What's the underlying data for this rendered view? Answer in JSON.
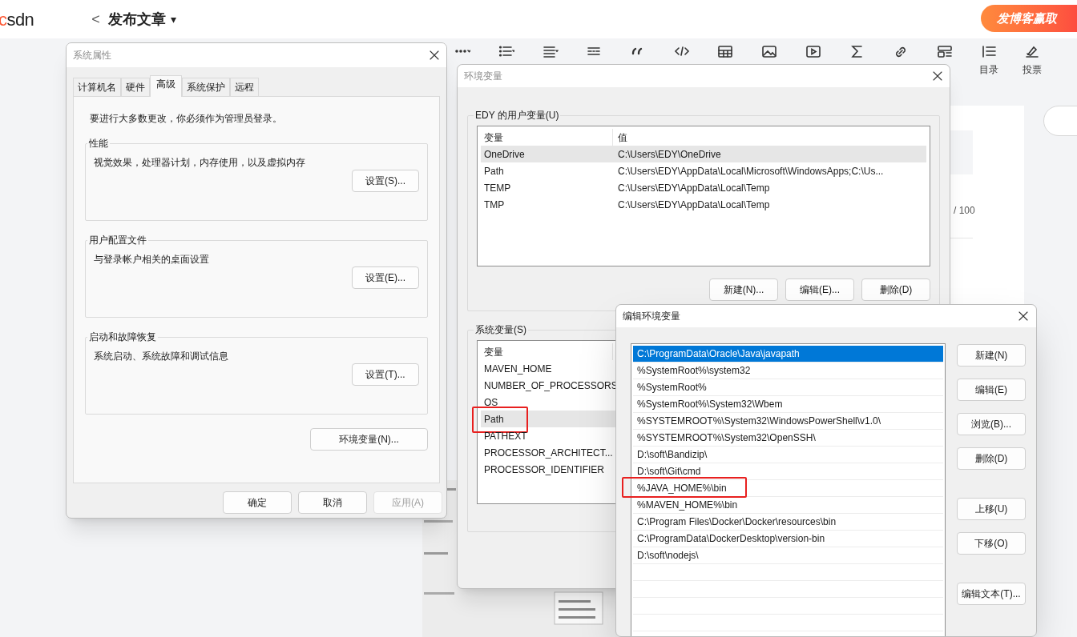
{
  "editor": {
    "logo": "csdn",
    "back": "<",
    "title": "发布文章",
    "title_caret": "▾",
    "promo_button": "发博客赢取",
    "toolbar": [
      {
        "kind": "more"
      },
      {
        "kind": "bullets"
      },
      {
        "kind": "align"
      },
      {
        "kind": "rule"
      },
      {
        "kind": "quote"
      },
      {
        "kind": "code"
      },
      {
        "kind": "table"
      },
      {
        "kind": "image"
      },
      {
        "kind": "video"
      },
      {
        "kind": "formula"
      },
      {
        "kind": "link"
      },
      {
        "kind": "layout"
      },
      {
        "kind": "outline",
        "label": "目录"
      },
      {
        "kind": "vote",
        "label": "投票"
      }
    ],
    "title_counter": "/ 100"
  },
  "system_properties": {
    "title": "系统属性",
    "tabs": [
      {
        "label": "计算机名",
        "selected": false
      },
      {
        "label": "硬件",
        "selected": false
      },
      {
        "label": "高级",
        "selected": true
      },
      {
        "label": "系统保护",
        "selected": false
      },
      {
        "label": "远程",
        "selected": false
      }
    ],
    "notice": "要进行大多数更改，你必须作为管理员登录。",
    "groups": [
      {
        "title": "性能",
        "description": "视觉效果，处理器计划，内存使用，以及虚拟内存",
        "button": "设置(S)..."
      },
      {
        "title": "用户配置文件",
        "description": "与登录帐户相关的桌面设置",
        "button": "设置(E)..."
      },
      {
        "title": "启动和故障恢复",
        "description": "系统启动、系统故障和调试信息",
        "button": "设置(T)..."
      }
    ],
    "env_button": "环境变量(N)...",
    "buttons": [
      {
        "label": "确定",
        "disabled": false
      },
      {
        "label": "取消",
        "disabled": false
      },
      {
        "label": "应用(A)",
        "disabled": true
      }
    ]
  },
  "environment_variables": {
    "title": "环境变量",
    "user_group": {
      "title": "EDY 的用户变量(U)",
      "columns": [
        "变量",
        "值"
      ],
      "rows": [
        {
          "name": "OneDrive",
          "value": "C:\\Users\\EDY\\OneDrive",
          "selected": true
        },
        {
          "name": "Path",
          "value": "C:\\Users\\EDY\\AppData\\Local\\Microsoft\\WindowsApps;C:\\Us...",
          "selected": false
        },
        {
          "name": "TEMP",
          "value": "C:\\Users\\EDY\\AppData\\Local\\Temp",
          "selected": false
        },
        {
          "name": "TMP",
          "value": "C:\\Users\\EDY\\AppData\\Local\\Temp",
          "selected": false
        }
      ],
      "buttons": [
        "新建(N)...",
        "编辑(E)...",
        "删除(D)"
      ]
    },
    "system_group": {
      "title": "系统变量(S)",
      "columns": [
        "变量"
      ],
      "rows": [
        {
          "name": "MAVEN_HOME",
          "selected": false,
          "annotated": false
        },
        {
          "name": "NUMBER_OF_PROCESSORS",
          "selected": false,
          "annotated": false
        },
        {
          "name": "OS",
          "selected": false,
          "annotated": false
        },
        {
          "name": "Path",
          "selected": true,
          "annotated": true
        },
        {
          "name": "PATHEXT",
          "selected": false,
          "annotated": false
        },
        {
          "name": "PROCESSOR_ARCHITECT...",
          "selected": false,
          "annotated": false
        },
        {
          "name": "PROCESSOR_IDENTIFIER",
          "selected": false,
          "annotated": false
        }
      ]
    }
  },
  "edit_variable": {
    "title": "编辑环境变量",
    "entries": [
      {
        "text": "C:\\ProgramData\\Oracle\\Java\\javapath",
        "selected": true,
        "annotated": false
      },
      {
        "text": "%SystemRoot%\\system32",
        "selected": false,
        "annotated": false
      },
      {
        "text": "%SystemRoot%",
        "selected": false,
        "annotated": false
      },
      {
        "text": "%SystemRoot%\\System32\\Wbem",
        "selected": false,
        "annotated": false
      },
      {
        "text": "%SYSTEMROOT%\\System32\\WindowsPowerShell\\v1.0\\",
        "selected": false,
        "annotated": false
      },
      {
        "text": "%SYSTEMROOT%\\System32\\OpenSSH\\",
        "selected": false,
        "annotated": false
      },
      {
        "text": "D:\\soft\\Bandizip\\",
        "selected": false,
        "annotated": false
      },
      {
        "text": "D:\\soft\\Git\\cmd",
        "selected": false,
        "annotated": false
      },
      {
        "text": "%JAVA_HOME%\\bin",
        "selected": false,
        "annotated": true
      },
      {
        "text": "%MAVEN_HOME%\\bin",
        "selected": false,
        "annotated": false
      },
      {
        "text": "C:\\Program Files\\Docker\\Docker\\resources\\bin",
        "selected": false,
        "annotated": false
      },
      {
        "text": "C:\\ProgramData\\DockerDesktop\\version-bin",
        "selected": false,
        "annotated": false
      },
      {
        "text": "D:\\soft\\nodejs\\",
        "selected": false,
        "annotated": false
      }
    ],
    "button_groups": [
      [
        "新建(N)",
        "编辑(E)",
        "浏览(B)...",
        "删除(D)"
      ],
      [
        "上移(U)",
        "下移(O)"
      ],
      [
        "编辑文本(T)..."
      ]
    ]
  }
}
